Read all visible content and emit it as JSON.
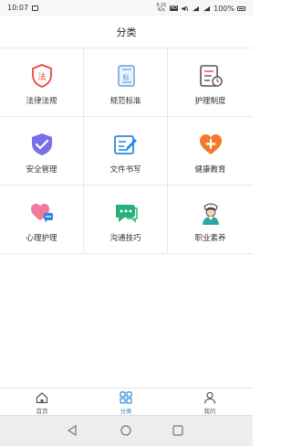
{
  "status_bar": {
    "time": "10:07",
    "net_speed_value": "0.21",
    "net_speed_unit": "K/s",
    "hd_badge": "HD",
    "battery_text": "100%"
  },
  "header": {
    "title": "分类"
  },
  "categories": [
    {
      "label": "法律法规",
      "icon": "law-shield-icon",
      "glyph": "法"
    },
    {
      "label": "规范标准",
      "icon": "standard-document-icon",
      "glyph": "标"
    },
    {
      "label": "护理制度",
      "icon": "nursing-system-icon"
    },
    {
      "label": "安全管理",
      "icon": "security-shield-check-icon"
    },
    {
      "label": "文件书写",
      "icon": "document-writing-icon"
    },
    {
      "label": "健康教育",
      "icon": "health-heart-plus-icon"
    },
    {
      "label": "心理护理",
      "icon": "heart-chat-icon"
    },
    {
      "label": "沟通技巧",
      "icon": "chat-bubbles-icon"
    },
    {
      "label": "职业素养",
      "icon": "nurse-icon"
    }
  ],
  "tabbar": {
    "tabs": [
      {
        "label": "首页",
        "icon": "home-icon",
        "active": false
      },
      {
        "label": "分类",
        "icon": "category-grid-icon",
        "active": true
      },
      {
        "label": "我的",
        "icon": "user-icon",
        "active": false
      }
    ]
  },
  "colors": {
    "accent": "#2b8ad8",
    "law_red": "#e8473b",
    "standard_blue": "#4a8fe0",
    "shield_purple": "#7b6fe8",
    "doc_blue": "#2f86e0",
    "health_orange": "#f07a2a",
    "heart_pink": "#f07a9a",
    "chat_green": "#27b07a"
  }
}
